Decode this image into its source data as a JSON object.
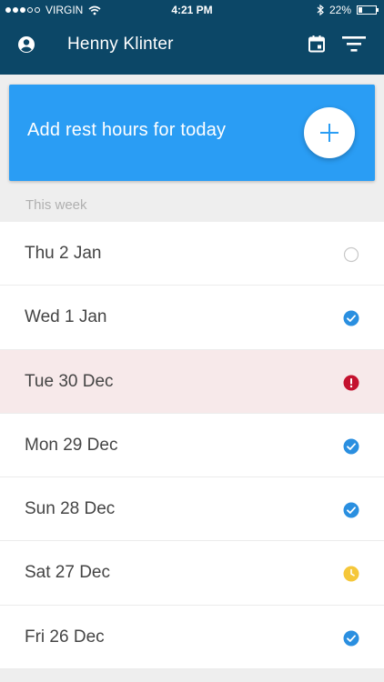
{
  "status_bar": {
    "carrier": "VIRGIN",
    "time": "4:21 PM",
    "battery": "22%",
    "battery_level": 0.22,
    "signal_dots_filled": 3,
    "signal_dots_total": 5
  },
  "header": {
    "user_name": "Henny Klinter",
    "left_icon": "account-icon",
    "right_icons": [
      "calendar-icon",
      "filter-icon"
    ]
  },
  "add_card": {
    "label": "Add rest hours for today",
    "button_icon": "plus-icon"
  },
  "section": {
    "label": "This week"
  },
  "days": [
    {
      "label": "Thu 2 Jan",
      "status": "empty"
    },
    {
      "label": "Wed 1 Jan",
      "status": "complete"
    },
    {
      "label": "Tue 30 Dec",
      "status": "error"
    },
    {
      "label": "Mon 29 Dec",
      "status": "complete"
    },
    {
      "label": "Sun 28 Dec",
      "status": "complete"
    },
    {
      "label": "Sat 27 Dec",
      "status": "pending"
    },
    {
      "label": "Fri 26 Dec",
      "status": "complete"
    }
  ],
  "colors": {
    "header_bg": "#0c4767",
    "accent": "#2a9df4",
    "complete": "#2a8fe0",
    "error": "#c4122f",
    "pending": "#f5c73a",
    "alert_row_bg": "#f7e9ea"
  }
}
